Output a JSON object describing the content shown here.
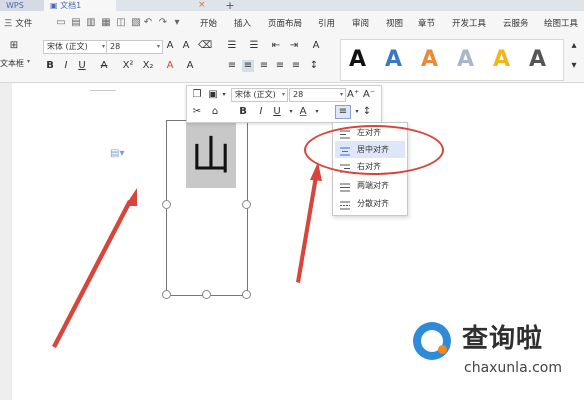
{
  "tabs": {
    "app": "WPS",
    "doc": "文档1",
    "plus": "+",
    "close": "×"
  },
  "menubar": {
    "file": "三 文件",
    "items": [
      "开始",
      "插入",
      "页面布局",
      "引用",
      "审阅",
      "视图",
      "章节",
      "开发工具",
      "云服务",
      "绘图工具"
    ]
  },
  "ribbon": {
    "textbox_label": "文本框",
    "font_name": "宋体 (正文)",
    "font_size": "28",
    "style_letters": [
      "A",
      "A",
      "A",
      "A",
      "A",
      "A"
    ],
    "style_colors": [
      "#111111",
      "#3a78c6",
      "#e88a36",
      "#aab7c8",
      "#f2b51c",
      "#555555"
    ]
  },
  "mini_toolbar": {
    "font_name": "宋体 (正文)",
    "font_size": "28",
    "bold": "B",
    "italic": "I",
    "underline": "U",
    "font_color": "A",
    "grow": "A⁺",
    "shrink": "A⁻"
  },
  "textbox": {
    "char": "山"
  },
  "align_menu": {
    "items": [
      {
        "label": "左对齐",
        "highlighted": false
      },
      {
        "label": "居中对齐",
        "highlighted": true
      },
      {
        "label": "右对齐",
        "highlighted": false
      },
      {
        "label": "两端对齐",
        "highlighted": false
      },
      {
        "label": "分散对齐",
        "highlighted": false
      }
    ]
  },
  "watermark": {
    "brand": "查询啦",
    "url": "chaxunla.com"
  },
  "colors": {
    "annotation_red": "#d8453b",
    "accent_blue": "#3a6fd0"
  }
}
